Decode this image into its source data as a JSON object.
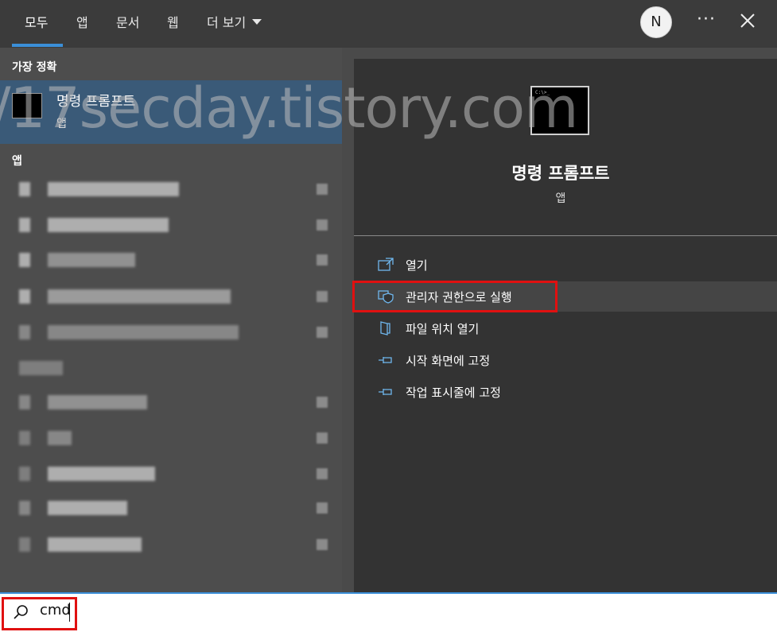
{
  "tabs": [
    {
      "label": "모두"
    },
    {
      "label": "앱"
    },
    {
      "label": "문서"
    },
    {
      "label": "웹"
    },
    {
      "label": "더 보기"
    }
  ],
  "user": {
    "initial": "N"
  },
  "more_icon": "···",
  "left": {
    "best_match_label": "가장 정확",
    "best_match": {
      "title": "명령 프롬프트",
      "type": "앱"
    },
    "apps_label": "앱"
  },
  "right": {
    "app_title": "명령 프롬프트",
    "app_type": "앱",
    "actions": [
      {
        "label": "열기",
        "icon": "open-icon"
      },
      {
        "label": "관리자 권한으로 실행",
        "icon": "shield-icon"
      },
      {
        "label": "파일 위치 열기",
        "icon": "file-location-icon"
      },
      {
        "label": "시작 화면에 고정",
        "icon": "pin-icon"
      },
      {
        "label": "작업 표시줄에 고정",
        "icon": "pin-icon"
      }
    ]
  },
  "watermark": "/17secday.tistory.com",
  "search": {
    "value": "cmd"
  },
  "colors": {
    "accent": "#3b8fd8",
    "highlight": "#e01010"
  }
}
